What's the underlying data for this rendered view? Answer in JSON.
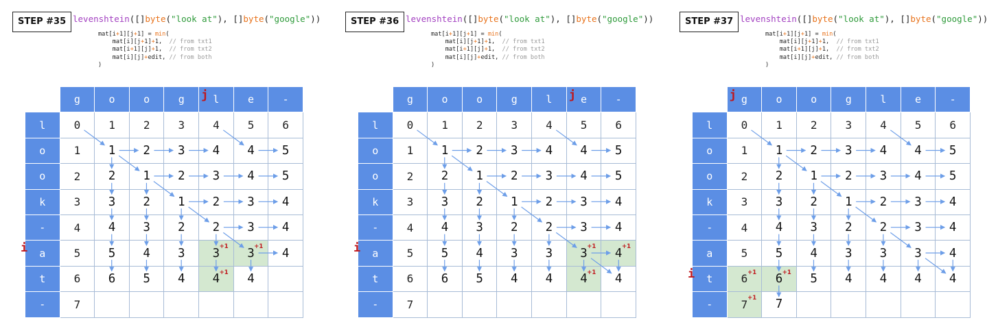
{
  "call": {
    "fn": "levenshtein",
    "p1": "([]",
    "kw1": "byte",
    "p2": "(",
    "s1": "\"look at\"",
    "p3": "), []",
    "kw2": "byte",
    "p4": "(",
    "s2": "\"google\"",
    "p5": "))"
  },
  "code": {
    "line1a": "mat[i",
    "line1b": "+",
    "line1c": "1][j",
    "line1d": "+",
    "line1e": "1] = ",
    "line1f": "min",
    "line1g": "(",
    "line2a": "    mat[i][j",
    "line2b": "+",
    "line2c": "1]",
    "line2d": "+",
    "line2e": "1,  ",
    "line2f": "// from txt1",
    "line3a": "    mat[i",
    "line3b": "+",
    "line3c": "1][j]",
    "line3d": "+",
    "line3e": "1,  ",
    "line3f": "// from txt2",
    "line4a": "    mat[i][j]",
    "line4b": "+",
    "line4c": "edit, ",
    "line4d": "// from both",
    "line5": ")"
  },
  "columns": [
    "g",
    "o",
    "o",
    "g",
    "l",
    "e",
    "-"
  ],
  "rows": [
    "l",
    "o",
    "o",
    "k",
    "-",
    "a",
    "t",
    "-"
  ],
  "plus_label": "+1",
  "i_marker": "i",
  "j_marker": "j",
  "steps": [
    {
      "label": "STEP #35",
      "j_col": 4,
      "i_row": 5,
      "cells": [
        [
          "0",
          "1",
          "2",
          "3",
          "4",
          "5",
          "6"
        ],
        [
          "1",
          "1",
          "2",
          "3",
          "4",
          "4",
          "5"
        ],
        [
          "2",
          "2",
          "1",
          "2",
          "3",
          "4",
          "5"
        ],
        [
          "3",
          "3",
          "2",
          "1",
          "2",
          "3",
          "4"
        ],
        [
          "4",
          "4",
          "3",
          "2",
          "2",
          "3",
          "4"
        ],
        [
          "5",
          "5",
          "4",
          "3",
          "3",
          "3",
          "4"
        ],
        [
          "6",
          "6",
          "5",
          "4",
          "4",
          "4",
          ""
        ],
        [
          "7",
          "",
          "",
          "",
          "",
          "",
          ""
        ]
      ],
      "highlights": [
        [
          5,
          4
        ],
        [
          5,
          5
        ],
        [
          6,
          4
        ]
      ]
    },
    {
      "label": "STEP #36",
      "j_col": 5,
      "i_row": 5,
      "cells": [
        [
          "0",
          "1",
          "2",
          "3",
          "4",
          "5",
          "6"
        ],
        [
          "1",
          "1",
          "2",
          "3",
          "4",
          "4",
          "5"
        ],
        [
          "2",
          "2",
          "1",
          "2",
          "3",
          "4",
          "5"
        ],
        [
          "3",
          "3",
          "2",
          "1",
          "2",
          "3",
          "4"
        ],
        [
          "4",
          "4",
          "3",
          "2",
          "2",
          "3",
          "4"
        ],
        [
          "5",
          "5",
          "4",
          "3",
          "3",
          "3",
          "4"
        ],
        [
          "6",
          "6",
          "5",
          "4",
          "4",
          "4",
          "4"
        ],
        [
          "7",
          "",
          "",
          "",
          "",
          "",
          ""
        ]
      ],
      "highlights": [
        [
          5,
          5
        ],
        [
          5,
          6
        ],
        [
          6,
          5
        ]
      ]
    },
    {
      "label": "STEP #37",
      "j_col": 0,
      "i_row": 6,
      "cells": [
        [
          "0",
          "1",
          "2",
          "3",
          "4",
          "5",
          "6"
        ],
        [
          "1",
          "1",
          "2",
          "3",
          "4",
          "4",
          "5"
        ],
        [
          "2",
          "2",
          "1",
          "2",
          "3",
          "4",
          "5"
        ],
        [
          "3",
          "3",
          "2",
          "1",
          "2",
          "3",
          "4"
        ],
        [
          "4",
          "4",
          "3",
          "2",
          "2",
          "3",
          "4"
        ],
        [
          "5",
          "5",
          "4",
          "3",
          "3",
          "3",
          "4"
        ],
        [
          "6",
          "6",
          "5",
          "4",
          "4",
          "4",
          "4"
        ],
        [
          "7",
          "7",
          "",
          "",
          "",
          "",
          ""
        ]
      ],
      "highlights": [
        [
          6,
          0
        ],
        [
          6,
          1
        ],
        [
          7,
          0
        ]
      ]
    }
  ],
  "colors": {
    "header": "#5b8ee4",
    "highlight": "#d4e8d0",
    "arrow": "#6d9ee8",
    "marker": "#c0171c"
  }
}
